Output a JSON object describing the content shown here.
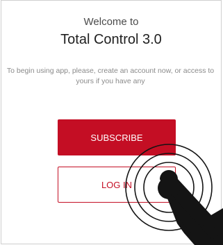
{
  "welcome": {
    "greeting": "Welcome to",
    "title": "Total Control 3.0",
    "message": "To begin using app, please, create an account now, or access to yours if you have any"
  },
  "buttons": {
    "subscribe_label": "SUBSCRIBE",
    "login_label": "LOG IN"
  },
  "colors": {
    "accent": "#c40e24",
    "tap_hand": "#141414"
  },
  "icons": {
    "tap_gesture": "tap-hand-icon"
  }
}
